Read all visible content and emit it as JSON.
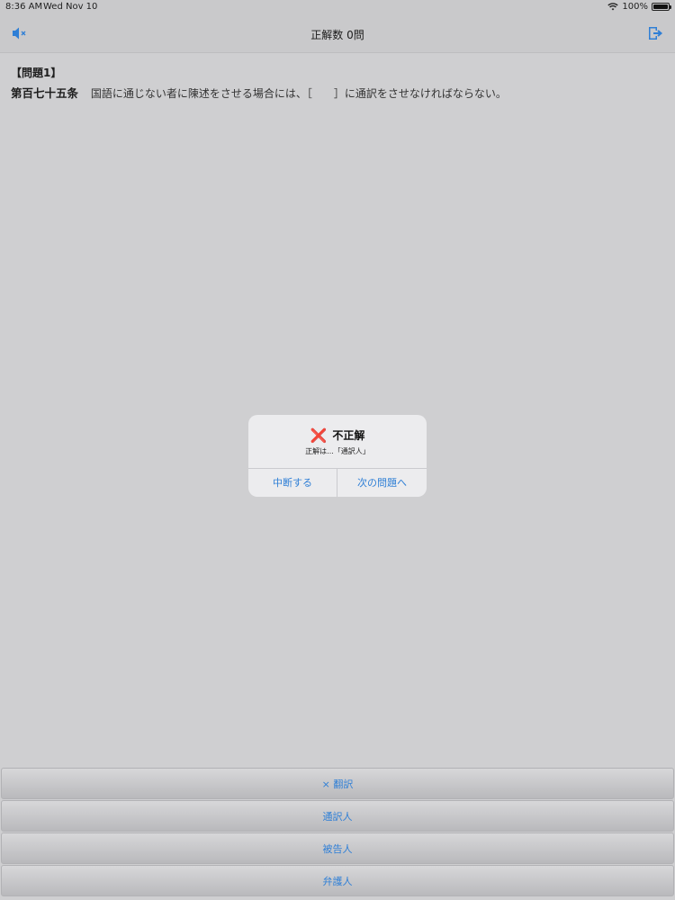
{
  "status_bar": {
    "time": "8:36 AM",
    "date": "Wed Nov 10",
    "battery": "100%"
  },
  "nav": {
    "title": "正解数 0問",
    "left_icon": "speaker-muted-icon",
    "right_icon": "exit-icon"
  },
  "question": {
    "label": "【問題1】",
    "article": "第百七十五条",
    "text": "国語に通じない者に陳述をさせる場合には、［　　］に通訳をさせなければならない。"
  },
  "dialog": {
    "icon": "cross-mark",
    "title": "不正解",
    "message": "正解は...「通訳人」",
    "buttons": [
      "中断する",
      "次の問題へ"
    ]
  },
  "answers": [
    "× 翻訳",
    "通訳人",
    "被告人",
    "弁護人"
  ],
  "colors": {
    "accent": "#2f7fd6",
    "error": "#d8262c",
    "background": "#cfcfd1"
  }
}
